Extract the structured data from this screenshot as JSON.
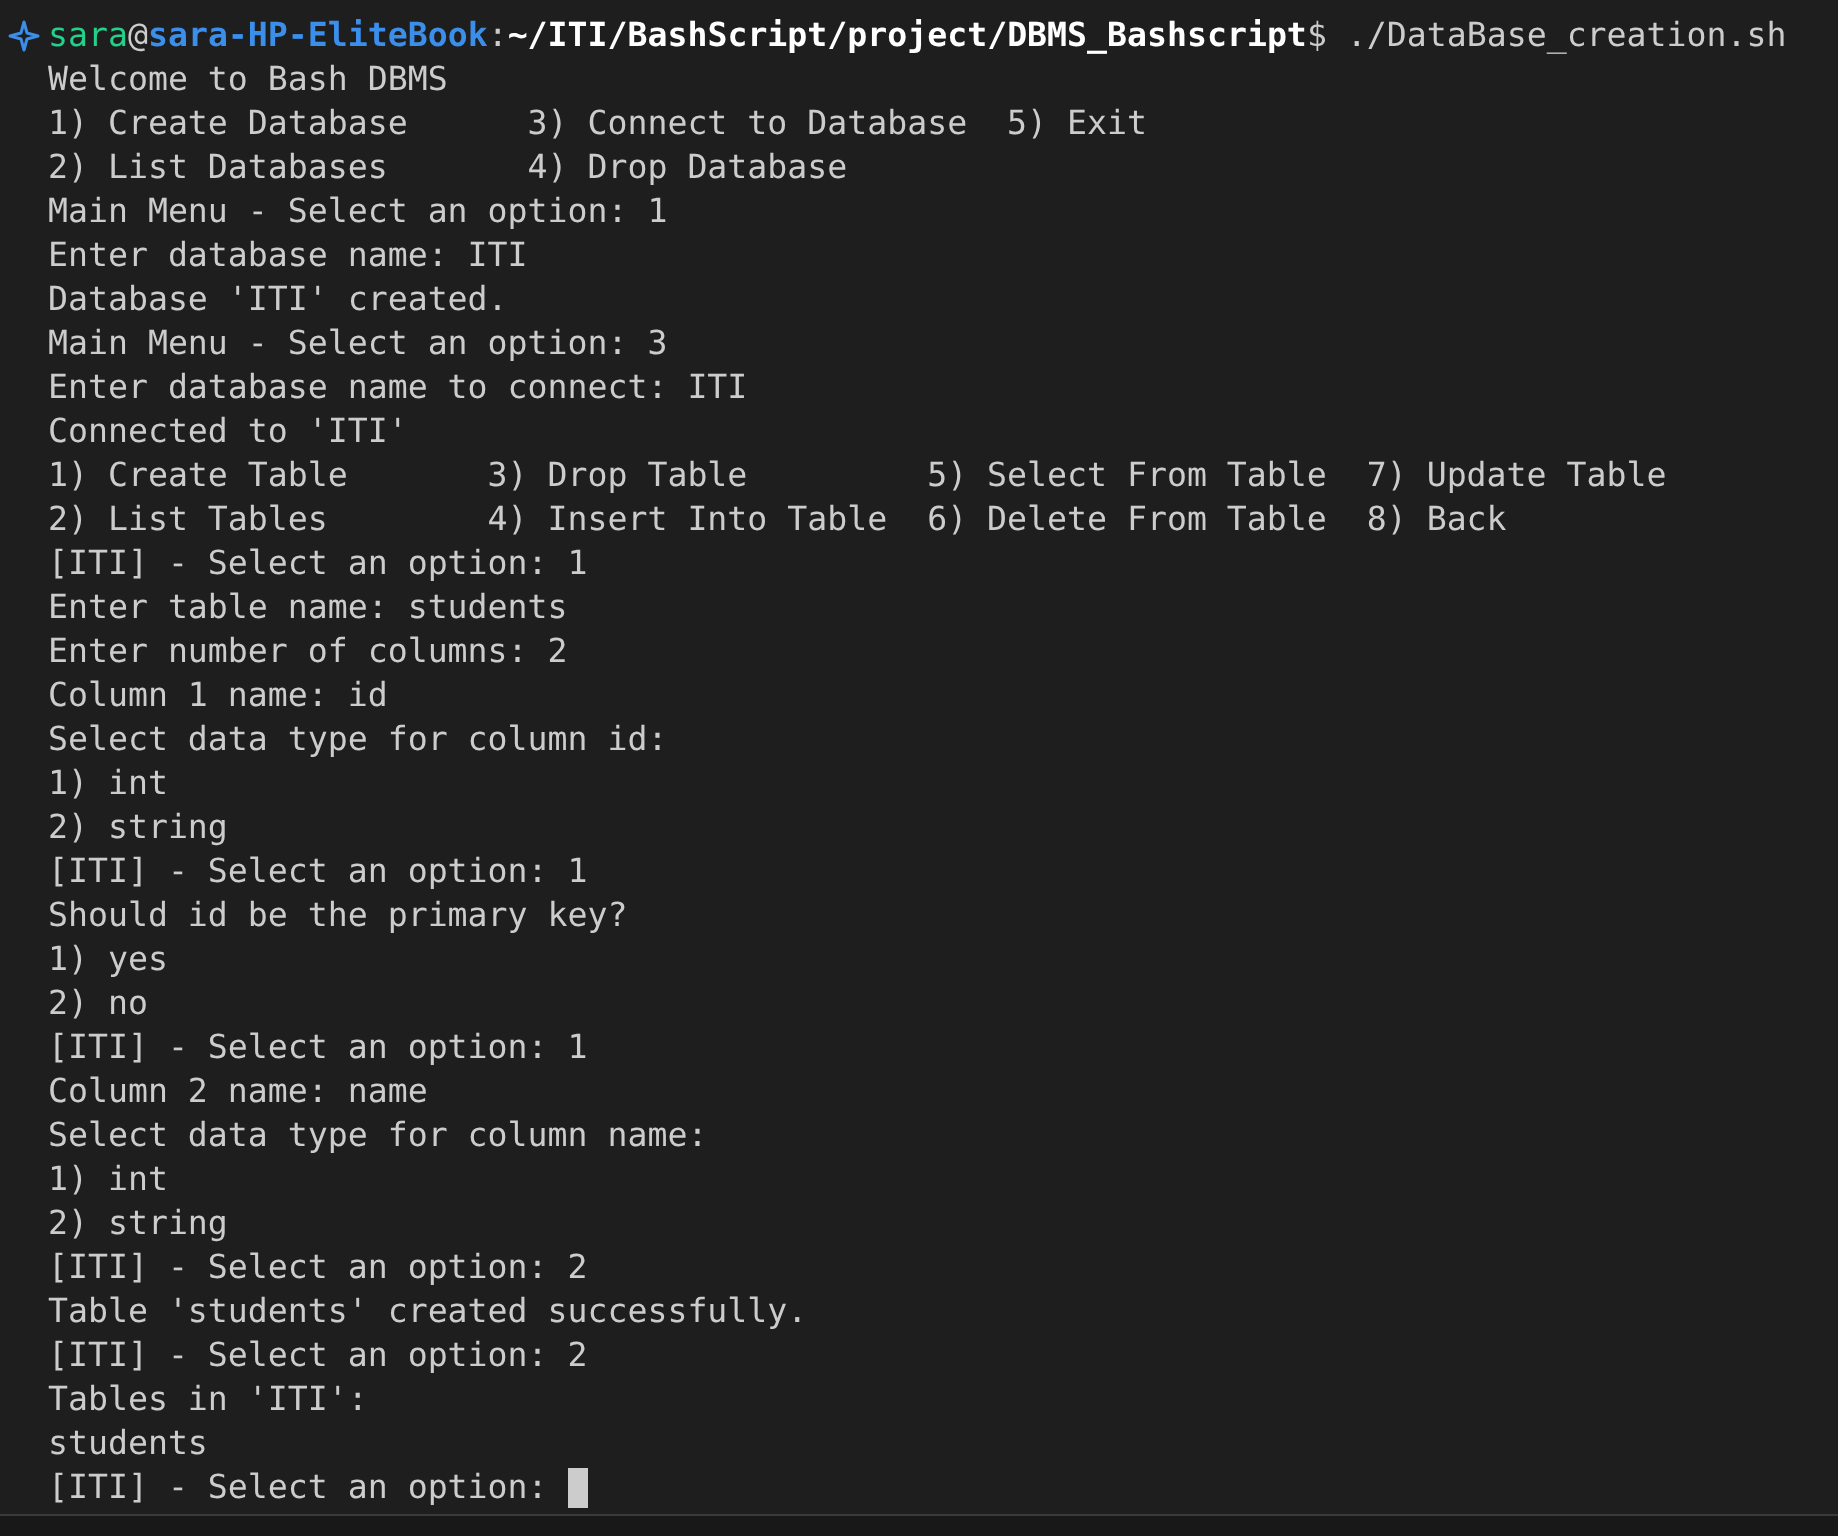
{
  "prompt": {
    "user": "sara",
    "at": "@",
    "host": "sara-HP-EliteBook",
    "colon": ":",
    "path": "~/ITI/BashScript/project/DBMS_Bashscript",
    "symbol": "$",
    "command": " ./DataBase_creation.sh"
  },
  "output_lines": [
    "Welcome to Bash DBMS",
    "1) Create Database      3) Connect to Database  5) Exit",
    "2) List Databases       4) Drop Database",
    "Main Menu - Select an option: 1",
    "Enter database name: ITI",
    "Database 'ITI' created.",
    "Main Menu - Select an option: 3",
    "Enter database name to connect: ITI",
    "Connected to 'ITI'",
    "1) Create Table       3) Drop Table         5) Select From Table  7) Update Table",
    "2) List Tables        4) Insert Into Table  6) Delete From Table  8) Back",
    "[ITI] - Select an option: 1",
    "Enter table name: students",
    "Enter number of columns: 2",
    "Column 1 name: id",
    "Select data type for column id:",
    "1) int",
    "2) string",
    "[ITI] - Select an option: 1",
    "Should id be the primary key?",
    "1) yes",
    "2) no",
    "[ITI] - Select an option: 1",
    "Column 2 name: name",
    "Select data type for column name:",
    "1) int",
    "2) string",
    "[ITI] - Select an option: 2",
    "Table 'students' created successfully.",
    "[ITI] - Select an option: 2",
    "Tables in 'ITI':",
    "students"
  ],
  "input_line": {
    "text": "[ITI] - Select an option: ",
    "cursor": true
  }
}
